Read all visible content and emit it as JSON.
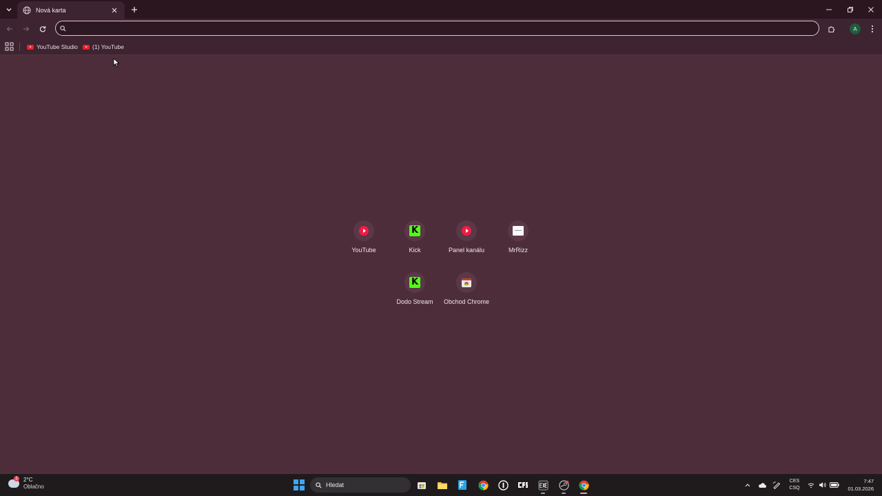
{
  "browser": {
    "tab": {
      "title": "Nová karta"
    },
    "omnibox": {
      "value": "",
      "placeholder": ""
    },
    "profile_initial": "A",
    "accent_color": "#4e2d3a"
  },
  "bookmarks": [
    {
      "label": "YouTube Studio",
      "icon": "youtube-icon"
    },
    {
      "label": "(1) YouTube",
      "icon": "youtube-icon"
    }
  ],
  "shortcuts": [
    {
      "label": "YouTube",
      "icon": "youtube-icon"
    },
    {
      "label": "Kick",
      "icon": "kick-icon"
    },
    {
      "label": "Panel kanálu",
      "icon": "youtube-icon"
    },
    {
      "label": "MrRizz",
      "icon": "mrrizz-icon"
    },
    {
      "label": "Dodo Stream",
      "icon": "kick-icon"
    },
    {
      "label": "Obchod Chrome",
      "icon": "chrome-web-store-icon"
    }
  ],
  "taskbar": {
    "weather": {
      "temp": "2°C",
      "condition": "Oblačno",
      "badge": "1"
    },
    "search_label": "Hledat",
    "language": {
      "line1": "CES",
      "line2": "CSQ"
    },
    "clock": {
      "time": "7:47",
      "date": "01.03.2026"
    },
    "apps": [
      "store-icon",
      "file-explorer-icon",
      "notepad-icon",
      "chrome-icon",
      "app-i-icon",
      "cfs-icon",
      "exe-icon",
      "steam-icon",
      "chrome-active-icon"
    ]
  }
}
